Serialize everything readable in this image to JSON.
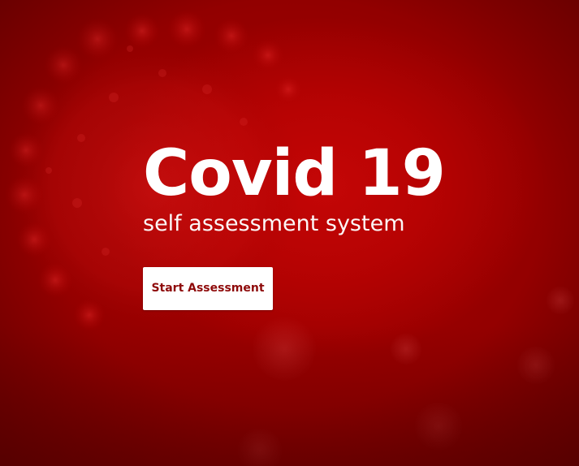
{
  "hero": {
    "title": "Covid 19",
    "subtitle": "self assessment system",
    "start_button_label": "Start Assessment"
  },
  "colors": {
    "background": "#b70303",
    "button_background": "#ffffff",
    "button_text": "#8e0a0a",
    "title_text": "#ffffff"
  },
  "decoration": {
    "background_image": "coronavirus-particle-illustration"
  }
}
